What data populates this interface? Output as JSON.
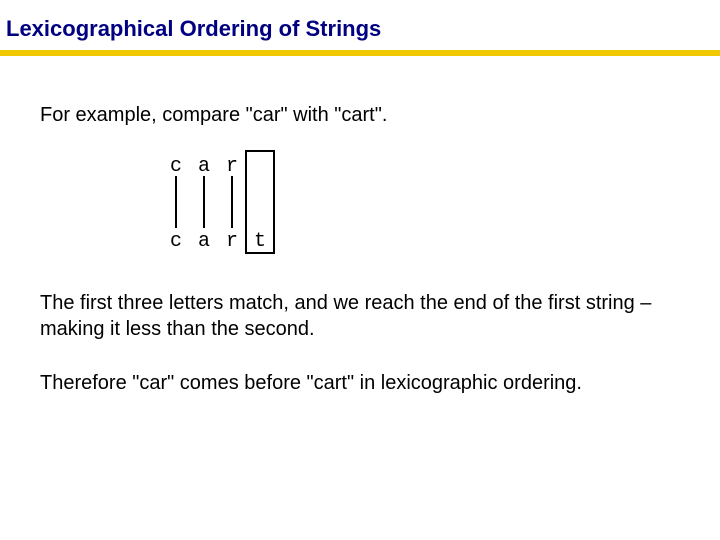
{
  "title": "Lexicographical Ordering of Strings",
  "intro": "For example, compare \"car\" with \"cart\".",
  "diagram": {
    "top": [
      "c",
      "a",
      "r",
      ""
    ],
    "bottom": [
      "c",
      "a",
      "r",
      "t"
    ]
  },
  "para1": "The first three letters match, and we reach the end of the first string – making it less than the second.",
  "para2": "Therefore \"car\" comes before \"cart\" in lexicographic ordering."
}
